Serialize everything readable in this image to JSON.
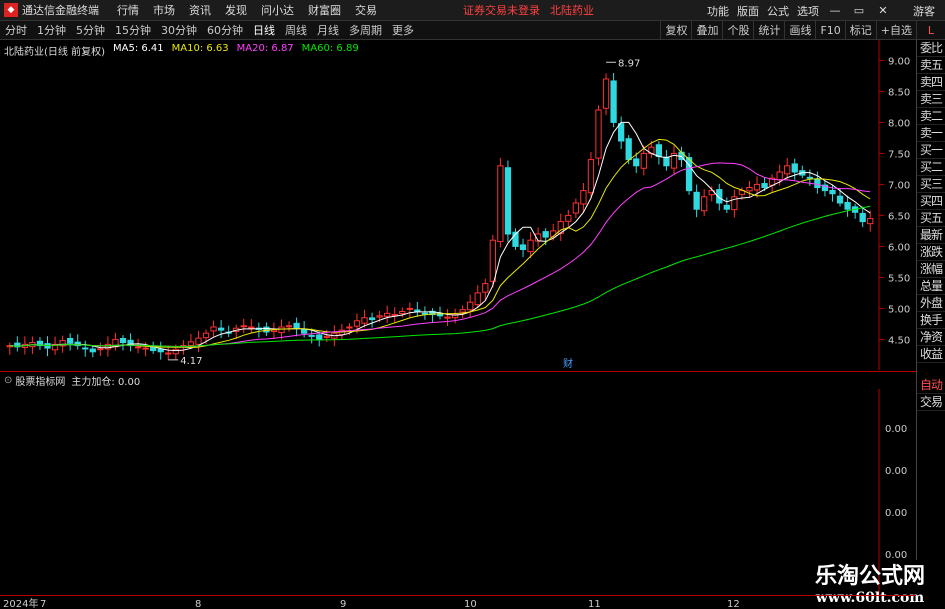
{
  "topbar": {
    "app_name": "通达信金融终端",
    "menus": [
      "行情",
      "市场",
      "资讯",
      "发现",
      "问小达",
      "财富圈",
      "交易"
    ],
    "status": "证券交易未登录",
    "stock_name": "北陆药业",
    "right_items": [
      "功能",
      "版面",
      "公式",
      "选项"
    ],
    "guest": "游客",
    "win_minimize": "—",
    "win_restore": "▭",
    "win_close": "✕"
  },
  "toolbar": {
    "periods": [
      "分时",
      "1分钟",
      "5分钟",
      "15分钟",
      "30分钟",
      "60分钟",
      "日线",
      "周线",
      "月线",
      "多周期",
      "更多"
    ],
    "active_period": "日线",
    "right_buttons": [
      "复权",
      "叠加",
      "个股",
      "统计",
      "画线",
      "F10",
      "标记",
      "+自选"
    ],
    "mode_label": "L"
  },
  "legend": {
    "title": "北陆药业(日线 前复权)",
    "ma5": "MA5: 6.41",
    "ma10": "MA10: 6.63",
    "ma20": "MA20: 6.87",
    "ma60": "MA60: 6.89",
    "colors": {
      "ma5": "#ffffff",
      "ma10": "#e8e800",
      "ma20": "#ff40ff",
      "ma60": "#00e800"
    }
  },
  "sidebar": {
    "items": [
      "委比",
      "卖五",
      "卖四",
      "卖三",
      "卖二",
      "卖一",
      "买一",
      "买二",
      "买三",
      "买四",
      "买五",
      "最新",
      "涨跌",
      "涨幅",
      "总量",
      "外盘",
      "换手",
      "净资",
      "收益"
    ],
    "bottom_items": [
      "自动",
      "交易"
    ]
  },
  "indicator": {
    "name": "股票指标网",
    "line": "主力加仓: 0.00",
    "yticks": [
      "0.00",
      "0.00",
      "0.00",
      "0.00"
    ]
  },
  "markers": {
    "fin_marker": "财"
  },
  "watermark": {
    "title": "乐淘公式网",
    "url": "www.60lt.com"
  },
  "chart_data": [
    {
      "type": "candlestick",
      "title": "北陆药业(日线 前复权)",
      "ylim": [
        4.2,
        9.2
      ],
      "yticks": [
        4.5,
        5.0,
        5.5,
        6.0,
        6.5,
        7.0,
        7.5,
        8.0,
        8.5,
        9.0
      ],
      "ytick_labels": [
        "4.50",
        "5.00",
        "5.50",
        "6.00",
        "6.50",
        "7.00",
        "7.50",
        "8.00",
        "8.50",
        "9.00"
      ],
      "xtick_labels": [
        "2024年",
        "7",
        "8",
        "9",
        "10",
        "11",
        "12"
      ],
      "annotations": [
        {
          "label": "8.97",
          "value": 8.97
        },
        {
          "label": "4.17",
          "value": 4.17
        }
      ],
      "close": [
        4.4,
        4.38,
        4.42,
        4.45,
        4.4,
        4.36,
        4.42,
        4.48,
        4.44,
        4.4,
        4.35,
        4.3,
        4.35,
        4.42,
        4.5,
        4.45,
        4.4,
        4.38,
        4.36,
        4.32,
        4.3,
        4.28,
        4.34,
        4.4,
        4.46,
        4.52,
        4.6,
        4.7,
        4.65,
        4.6,
        4.68,
        4.72,
        4.7,
        4.66,
        4.62,
        4.65,
        4.7,
        4.72,
        4.68,
        4.6,
        4.55,
        4.5,
        4.55,
        4.6,
        4.65,
        4.7,
        4.8,
        4.85,
        4.82,
        4.88,
        4.92,
        4.9,
        4.95,
        5.0,
        4.95,
        4.92,
        4.9,
        4.88,
        4.86,
        4.9,
        4.98,
        5.1,
        5.25,
        5.4,
        6.1,
        7.3,
        6.2,
        6.0,
        5.95,
        6.1,
        6.2,
        6.15,
        6.25,
        6.4,
        6.5,
        6.7,
        6.9,
        7.4,
        8.2,
        8.7,
        8.0,
        7.7,
        7.4,
        7.3,
        7.5,
        7.6,
        7.45,
        7.3,
        7.5,
        7.4,
        6.9,
        6.6,
        6.8,
        6.9,
        6.7,
        6.6,
        6.8,
        6.9,
        6.95,
        7.0,
        6.95,
        7.1,
        7.2,
        7.3,
        7.2,
        7.15,
        7.1,
        6.95,
        6.9,
        6.85,
        6.7,
        6.6,
        6.55,
        6.4,
        6.45
      ],
      "ma5_last": 6.41,
      "ma10_last": 6.63,
      "ma20_last": 6.87,
      "ma60_last": 6.89
    }
  ]
}
